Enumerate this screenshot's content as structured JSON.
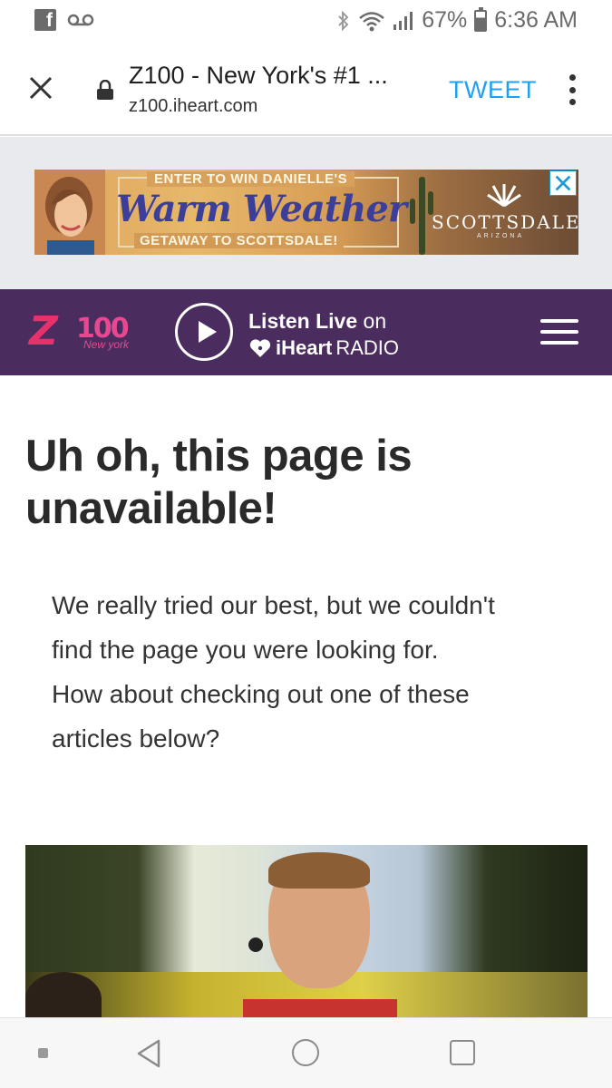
{
  "status_bar": {
    "left_icons": [
      "facebook-icon",
      "voicemail-icon"
    ],
    "right_icons": [
      "bluetooth-icon",
      "wifi-icon",
      "signal-icon"
    ],
    "battery": "67%",
    "time": "6:36 AM"
  },
  "browser": {
    "title": "Z100 - New York's #1 ...",
    "url": "z100.iheart.com",
    "tweet_label": "TWEET",
    "close_icon": "close-icon",
    "lock_icon": "lock-icon",
    "menu_icon": "overflow-menu-icon"
  },
  "ad": {
    "line1": "ENTER TO WIN DANIELLE'S",
    "line2": "Warm Weather",
    "line3": "GETAWAY TO SCOTTSDALE!",
    "brand": "SCOTTSDALE",
    "brand_sub": "ARIZONA",
    "close_icon": "close-icon"
  },
  "site_header": {
    "logo_main": "Z",
    "logo_number": "100",
    "logo_sub": "New york",
    "listen_bold": "Listen Live",
    "listen_rest": " on",
    "iheart_word": "iHeart",
    "radio_word": "RADIO",
    "colors": {
      "header_bg": "#4a2c5e",
      "logo_pink": "#e5326d"
    }
  },
  "content": {
    "title": "Uh oh, this page is unavailable!",
    "body_lines": [
      "We really tried our best, but we couldn't",
      "find the page you were looking for.",
      "How about checking out one of these",
      "articles below?"
    ]
  },
  "nav_bar": {
    "icons": [
      "nav-dot-icon",
      "back-icon",
      "home-icon",
      "recents-icon"
    ]
  },
  "colors": {
    "tweet": "#1da1f2",
    "ad_background": "#e8eaed"
  }
}
